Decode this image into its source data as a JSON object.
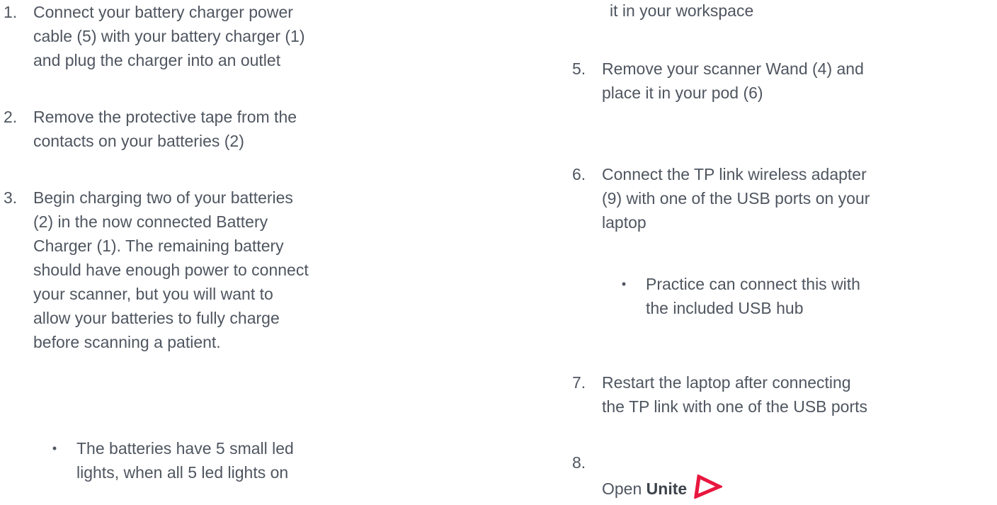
{
  "left_column": {
    "steps": [
      {
        "number": "1.",
        "text": "Connect your battery charger power\ncable (5) with your battery charger (1)\nand plug the charger into an outlet"
      },
      {
        "number": "2.",
        "text": "Remove the protective tape from the\ncontacts on your batteries (2)"
      },
      {
        "number": "3.",
        "text": "Begin charging two of your batteries\n(2) in the now connected Battery\nCharger (1). The remaining battery\nshould have enough power to connect\nyour scanner, but you will want to\nallow your batteries to fully charge\nbefore scanning a patient."
      }
    ],
    "sub_bullets": [
      {
        "bullet": "•",
        "text": "The batteries have 5 small led\nlights, when all 5 led lights on"
      }
    ]
  },
  "right_column": {
    "continued_text": "it in your workspace",
    "steps": [
      {
        "number": "5.",
        "text": "Remove your scanner Wand (4) and\nplace it in your pod (6)"
      },
      {
        "number": "6.",
        "text": "Connect the TP link wireless adapter\n(9) with one of the USB ports on your\nlaptop"
      },
      {
        "number": "7.",
        "text": "Restart the laptop after connecting\nthe TP link with one of the USB ports"
      }
    ],
    "sub_bullets": [
      {
        "bullet": "•",
        "text": "Practice can connect this with\nthe included USB hub"
      }
    ],
    "step8": {
      "number": "8.",
      "prefix": "Open ",
      "app_name": "Unite"
    }
  },
  "colors": {
    "text": "#4f5660",
    "logo": "#e8173f"
  },
  "icons": {
    "unite_logo": "unite-logo-icon"
  }
}
